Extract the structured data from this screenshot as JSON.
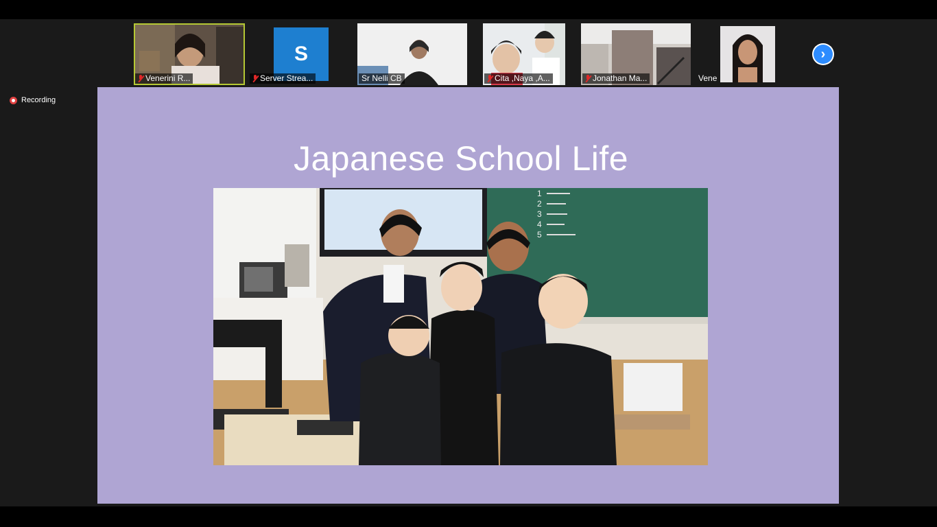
{
  "participants": [
    {
      "name": "Venerini R...",
      "active": true
    },
    {
      "name": "Server Strea...",
      "avatar_letter": "S"
    },
    {
      "name": "Sr Nelli CB"
    },
    {
      "name": "Cita ,Naya ,A..."
    },
    {
      "name": "Jonathan Ma..."
    },
    {
      "name": "Vene"
    }
  ],
  "recording": {
    "label": "Recording"
  },
  "slide": {
    "title": "Japanese School Life"
  },
  "blackboard_items": [
    "1",
    "2",
    "3",
    "4",
    "5"
  ],
  "icons": {
    "next": "chevron-right-icon",
    "mute": "mic-muted-icon",
    "record": "record-icon"
  },
  "colors": {
    "slide_bg": "#afa5d3",
    "active_speaker": "#b5c934",
    "zoom_blue": "#2d8cff",
    "recording_red": "#e04141"
  }
}
